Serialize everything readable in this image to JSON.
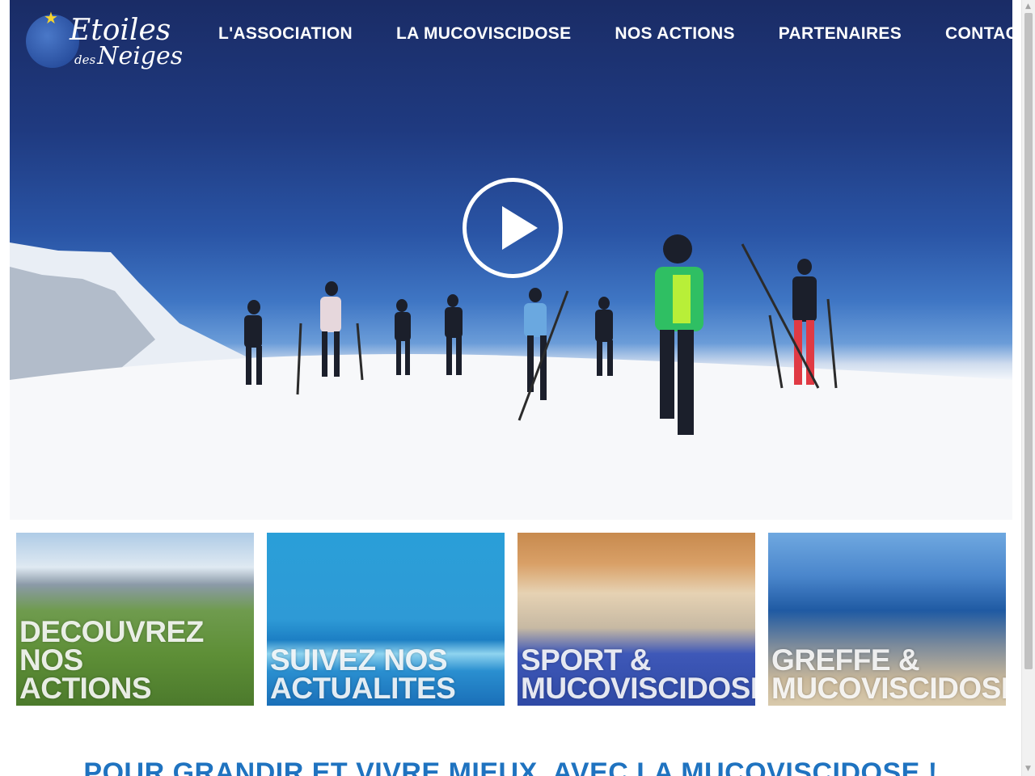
{
  "brand": {
    "line1": "Etoiles",
    "line2_small": "des",
    "line2": "Neiges"
  },
  "nav": {
    "items": [
      {
        "label": "L'ASSOCIATION"
      },
      {
        "label": "LA MUCOVISCIDOSE"
      },
      {
        "label": "NOS ACTIONS"
      },
      {
        "label": "PARTENAIRES"
      },
      {
        "label": "CONTACTS"
      }
    ]
  },
  "hero": {
    "play_icon": "play-icon"
  },
  "tiles": [
    {
      "label": "DECOUVREZ NOS\nACTIONS"
    },
    {
      "label": "SUIVEZ NOS\nACTUALITES"
    },
    {
      "label": "SPORT &\nMUCOVISCIDOSE"
    },
    {
      "label": "GREFFE &\nMUCOVISCIDOSE"
    }
  ],
  "tagline": "POUR GRANDIR ET VIVRE MIEUX, AVEC LA MUCOVISCIDOSE !",
  "colors": {
    "accent": "#1f73c0",
    "nav_text": "#ffffff",
    "sky": "#1f3a80"
  }
}
